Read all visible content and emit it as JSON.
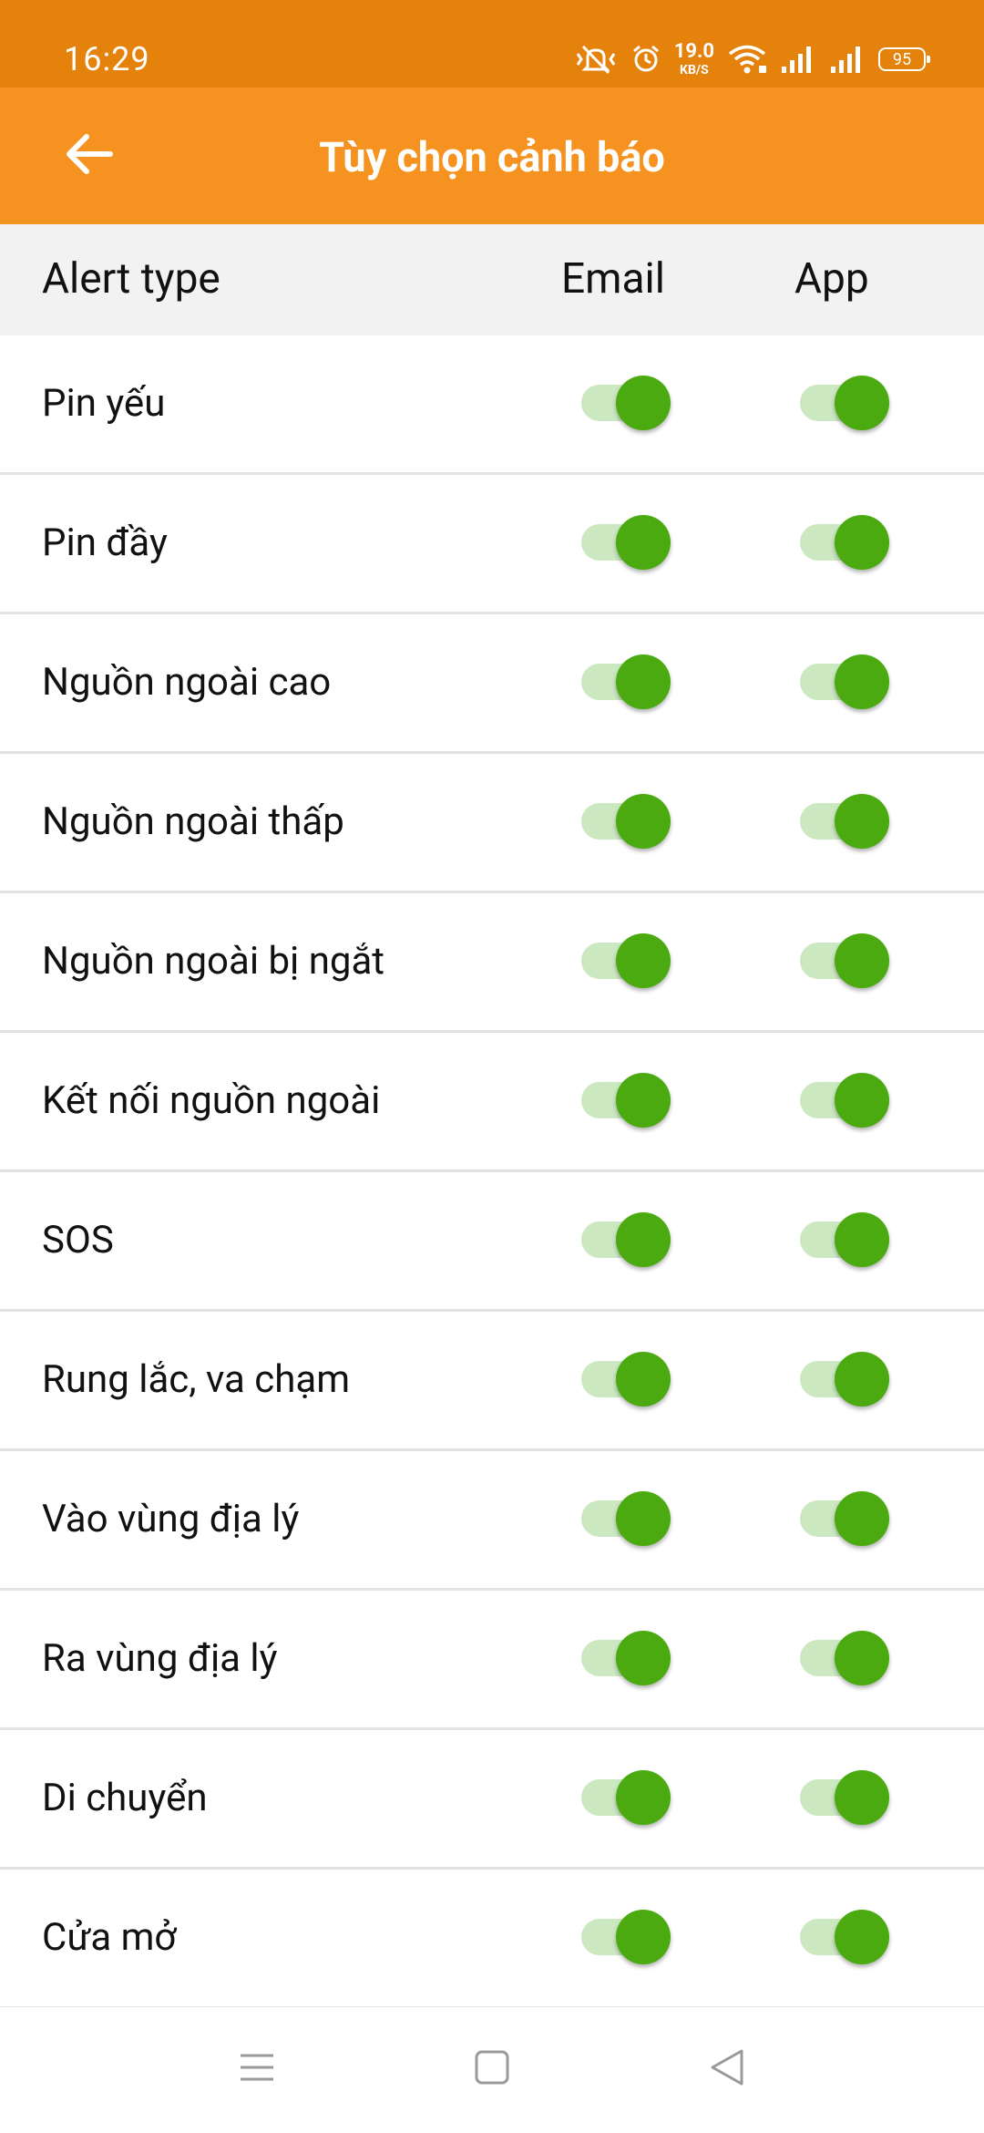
{
  "status_bar": {
    "time": "16:29",
    "net_speed_value": "19.0",
    "net_speed_unit": "KB/S",
    "battery_level": "95",
    "icons": [
      "vibrate-icon",
      "alarm-icon",
      "wifi-icon",
      "signal-icon",
      "signal-icon",
      "battery-icon"
    ]
  },
  "app_bar": {
    "title": "Tùy chọn cảnh báo",
    "back_icon": "arrow-left-icon"
  },
  "table": {
    "headers": {
      "type": "Alert type",
      "email": "Email",
      "app": "App"
    },
    "rows": [
      {
        "label": "Pin yếu",
        "email": true,
        "app": true
      },
      {
        "label": "Pin đầy",
        "email": true,
        "app": true
      },
      {
        "label": "Nguồn ngoài cao",
        "email": true,
        "app": true
      },
      {
        "label": "Nguồn ngoài thấp",
        "email": true,
        "app": true
      },
      {
        "label": "Nguồn ngoài bị ngắt",
        "email": true,
        "app": true
      },
      {
        "label": "Kết nối nguồn ngoài",
        "email": true,
        "app": true
      },
      {
        "label": "SOS",
        "email": true,
        "app": true
      },
      {
        "label": "Rung lắc, va chạm",
        "email": true,
        "app": true
      },
      {
        "label": "Vào vùng địa lý",
        "email": true,
        "app": true
      },
      {
        "label": "Ra vùng địa lý",
        "email": true,
        "app": true
      },
      {
        "label": "Di chuyển",
        "email": true,
        "app": true
      },
      {
        "label": "Cửa mở",
        "email": true,
        "app": true
      }
    ]
  },
  "nav_bar": {
    "icons": [
      "menu-icon",
      "home-square-icon",
      "back-triangle-icon"
    ]
  },
  "colors": {
    "status_bar": "#e5820b",
    "app_bar": "#f69320",
    "toggle_on_knob": "#4aaa10",
    "toggle_on_track": "#cbe8c1",
    "header_bg": "#f2f2f2"
  }
}
